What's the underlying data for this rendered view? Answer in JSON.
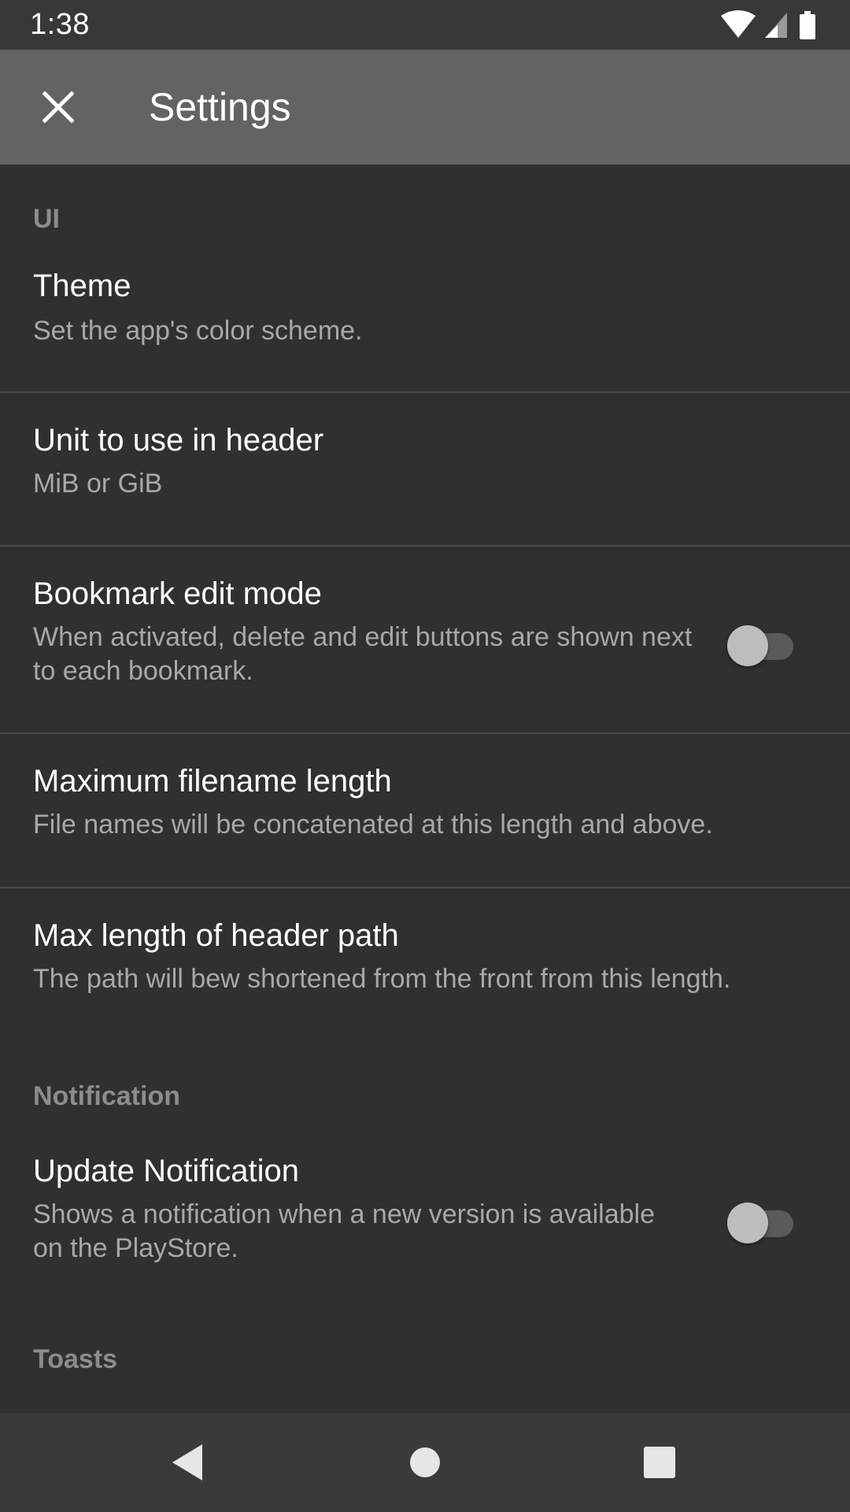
{
  "status_bar": {
    "time": "1:38",
    "icons": [
      "wifi-icon",
      "cell-signal-icon",
      "battery-icon"
    ]
  },
  "app_bar": {
    "title": "Settings",
    "close_icon": "close-icon"
  },
  "sections": [
    {
      "header": "UI",
      "items": [
        {
          "title": "Theme",
          "summary": "Set the app's color scheme."
        },
        {
          "title": "Unit to use in header",
          "summary": "MiB or GiB"
        },
        {
          "title": "Bookmark edit mode",
          "summary": "When activated, delete and edit buttons are shown next to each bookmark.",
          "switch": "off"
        },
        {
          "title": "Maximum filename length",
          "summary": "File names will be concatenated at this length and above."
        },
        {
          "title": "Max length of header path",
          "summary": "The path will bew shortened from the front from this length."
        }
      ]
    },
    {
      "header": "Notification",
      "items": [
        {
          "title": "Update Notification",
          "summary": "Shows a notification when a new version is available on the PlayStore.",
          "switch": "off"
        }
      ]
    },
    {
      "header": "Toasts",
      "items": []
    }
  ],
  "nav_bar": {
    "buttons": [
      "back-icon",
      "home-icon",
      "recents-icon"
    ]
  },
  "colors": {
    "background": "#303030",
    "app_bar": "#636363",
    "status_bar": "#383838",
    "category_text": "#8c8c8c",
    "summary_text": "#a8a8a8"
  }
}
